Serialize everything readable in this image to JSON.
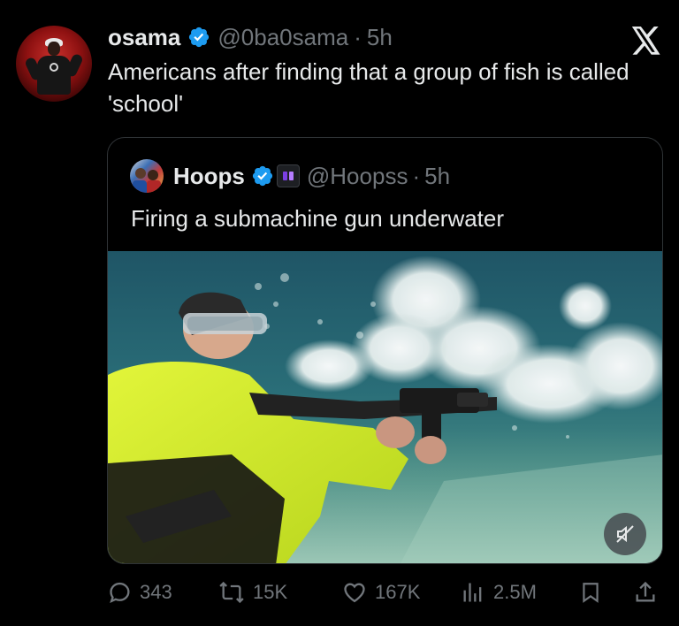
{
  "tweet": {
    "author_name": "osama",
    "handle": "@0ba0sama",
    "separator": "·",
    "time": "5h",
    "text": "Americans after finding that a group of fish is called 'school'"
  },
  "quoted_tweet": {
    "author_name": "Hoops",
    "handle": "@Hoopss",
    "separator": "·",
    "time": "5h",
    "text": "Firing a submachine gun underwater"
  },
  "actions": {
    "replies": "343",
    "reposts": "15K",
    "likes": "167K",
    "views": "2.5M"
  },
  "icons": {
    "verified": "verified-badge-icon",
    "close": "x-logo-icon",
    "mute": "mute-icon",
    "reply": "reply-icon",
    "repost": "repost-icon",
    "like": "heart-icon",
    "views": "views-icon",
    "bookmark": "bookmark-icon",
    "share": "share-icon"
  },
  "colors": {
    "background": "#000000",
    "text_primary": "#e7e9ea",
    "text_secondary": "#71767b",
    "verified": "#1d9bf0"
  }
}
